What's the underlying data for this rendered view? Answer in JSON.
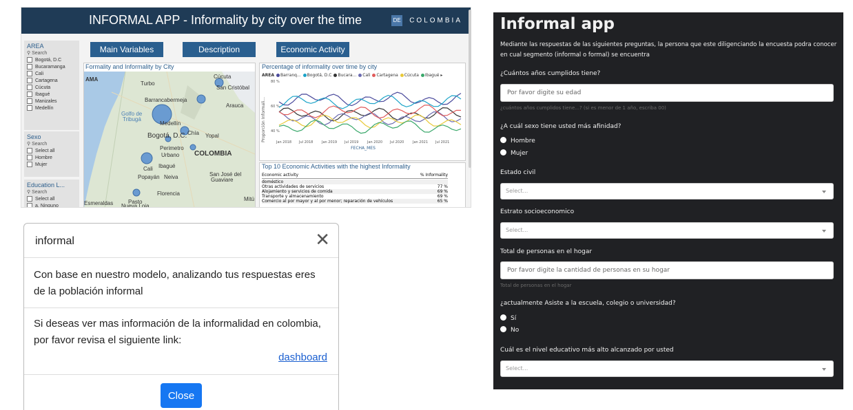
{
  "dashboard": {
    "title": "INFORMAL APP - Informality by city over the time",
    "brand": "COLOMBIA",
    "brand_badge": "DE",
    "nav_buttons": [
      "Main Variables",
      "Description",
      "Economic Activity"
    ],
    "area_filter": {
      "title": "AREA",
      "search": "⚲ Search",
      "options": [
        "Bogotá, D.C",
        "Bucaramanga",
        "Cali",
        "Cartagena",
        "Cúcuta",
        "Ibagué",
        "Manizales",
        "Medellín"
      ]
    },
    "sex_filter": {
      "title": "Sexo",
      "search": "⚲ Search",
      "options": [
        "Select all",
        "Hombre",
        "Mujer"
      ]
    },
    "education_filter": {
      "title": "Education L...",
      "search": "⚲ Search",
      "options": [
        "Select all",
        "a. Ninguno"
      ]
    },
    "map": {
      "title": "Formality and Informality by City",
      "labels": [
        "AMA",
        "Turbo",
        "Cúcuta",
        "San Cristóbal",
        "Barrancabermeja",
        "Arauca",
        "Golfo de",
        "Tribugá",
        "Medellín",
        "Bogotá, D.C.",
        "Chía",
        "Yopal",
        "Perimetro",
        "Urbano",
        "COLOMBIA",
        "Cali",
        "Ibagué",
        "Popayán",
        "Neiva",
        "San José del",
        "Guaviare",
        "Florencia",
        "Pasto",
        "Esmeraldas",
        "Nueva Loja",
        "Mitú"
      ]
    },
    "line_chart": {
      "title": "Percentage of informality over time by city",
      "legend_title": "AREA",
      "legend": [
        {
          "name": "Barranq...",
          "color": "#4a4a9c"
        },
        {
          "name": "Bogotá, D.C",
          "color": "#1aa3c8"
        },
        {
          "name": "Bucara...",
          "color": "#333333"
        },
        {
          "name": "Cali",
          "color": "#6b6bb0"
        },
        {
          "name": "Cartagena",
          "color": "#e05a5a"
        },
        {
          "name": "Cúcuta",
          "color": "#e8c93a"
        },
        {
          "name": "Ibagué",
          "color": "#3aa86b"
        }
      ],
      "ylabel": "Proporción Informali...",
      "yticks": [
        "80 %",
        "60 %",
        "40 %"
      ],
      "xticks": [
        "Jan 2018",
        "Jul 2018",
        "Jan 2019",
        "Jul 2019",
        "Jan 2020",
        "Jul 2020",
        "Jan 2021",
        "Jul 2021"
      ],
      "xlabel": "FECHA_MES"
    },
    "top_table": {
      "title": "Top 10 Economic Activities with the highest Informality",
      "col_activity": "Economic activity",
      "col_value": "% Informality",
      "rows": [
        {
          "activity": "doméstico",
          "value": ""
        },
        {
          "activity": "Otras actividades de servicios",
          "value": "77 %"
        },
        {
          "activity": "Alojamiento y servicios de comida",
          "value": "69 %"
        },
        {
          "activity": "Transporte y almacenamiento",
          "value": "69 %"
        },
        {
          "activity": "Comercio al por mayor y al por menor; reparación de vehículos",
          "value": "65 %"
        }
      ]
    }
  },
  "modal": {
    "title": "informal",
    "close_glyph": "✕",
    "result_text": "Con base en nuestro modelo, analizando tus respuestas eres de la población informal",
    "info_text": "Si deseas ver mas información de la informalidad en colombia, por favor revisa el siguiente link:",
    "link_label": "dashboard",
    "close_label": "Close"
  },
  "form": {
    "title": "Informal app",
    "intro": "Mediante las respuestas de las siguientes preguntas, la persona que este diligenciando la encuesta podra conocer en cual segmento (informal o formal) se encuentra",
    "age_label": "¿Cuántos años cumplidos tiene?",
    "age_placeholder": "Por favor digite su edad",
    "age_hint": "¿cuántos años cumplidos tiene...? (si es menor de 1 año, escriba 00)",
    "sex_label": "¿A cuál sexo tiene usted más afinidad?",
    "sex_options": [
      "Hombre",
      "Mujer"
    ],
    "civil_label": "Estado civil",
    "civil_placeholder": "Select...",
    "estrato_label": "Estrato socioeconomico",
    "estrato_placeholder": "Select...",
    "household_label": "Total de personas en el hogar",
    "household_placeholder": "Por favor digite la cantidad de personas en su hogar",
    "household_hint": "Total de personas en el hogar",
    "school_label": "¿actualmente Asiste a la escuela, colegio o universidad?",
    "school_options": [
      "Sí",
      "No"
    ],
    "education_label": "Cuál es el nivel educativo más alto alcanzado por usted",
    "education_placeholder": "Select..."
  }
}
